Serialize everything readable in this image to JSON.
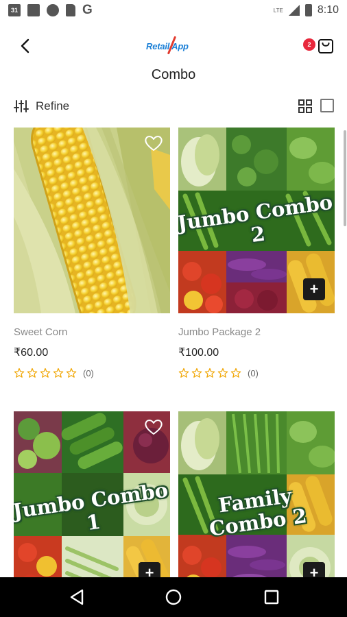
{
  "status_bar": {
    "calendar_day": "31",
    "network": "LTE",
    "time": "8:10",
    "left_icons": [
      "calendar-icon",
      "mail-icon",
      "security-heart-icon",
      "sd-card-icon",
      "google-icon"
    ],
    "right_icons": [
      "signal-icon",
      "battery-icon"
    ]
  },
  "header": {
    "logo_text": "Retail App",
    "cart_count": "2",
    "icons": [
      "back-arrow-icon",
      "shopping-bag-icon"
    ]
  },
  "page": {
    "title": "Combo"
  },
  "filter": {
    "refine_label": "Refine",
    "icons": [
      "sliders-icon",
      "grid-view-icon",
      "list-view-icon"
    ]
  },
  "products": [
    {
      "name": "Sweet Corn",
      "price": "₹60.00",
      "rating": 0,
      "rating_count": "(0)",
      "image_label": ""
    },
    {
      "name": "Jumbo Package 2",
      "price": "₹100.00",
      "rating": 0,
      "rating_count": "(0)",
      "image_label": "Jumbo Combo 2"
    },
    {
      "name": "",
      "price": "",
      "rating": 0,
      "rating_count": "",
      "image_label": "Jumbo Combo 1"
    },
    {
      "name": "",
      "price": "",
      "rating": 0,
      "rating_count": "",
      "image_label": "Family Combo 2"
    }
  ],
  "product_icons": [
    "heart-icon",
    "plus-icon",
    "star-icon"
  ],
  "nav_bar": {
    "icons": [
      "back-triangle-icon",
      "home-circle-icon",
      "recents-square-icon"
    ]
  },
  "colors": {
    "accent": "#1a7fd6",
    "badge": "#e8283c",
    "nav": "#000000",
    "combo_green": "#22502c"
  }
}
